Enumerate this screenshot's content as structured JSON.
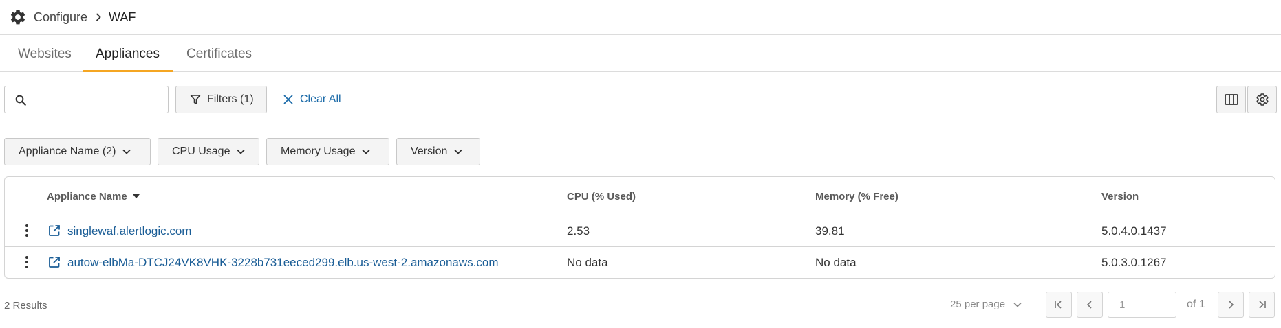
{
  "breadcrumb": {
    "parent": "Configure",
    "current": "WAF"
  },
  "tabs": [
    {
      "label": "Websites",
      "active": false
    },
    {
      "label": "Appliances",
      "active": true
    },
    {
      "label": "Certificates",
      "active": false
    }
  ],
  "toolbar": {
    "search_placeholder": "",
    "search_value": "",
    "filters_label": "Filters (1)",
    "clear_all_label": "Clear All"
  },
  "filter_chips": [
    {
      "label": "Appliance Name (2)"
    },
    {
      "label": "CPU Usage"
    },
    {
      "label": "Memory Usage"
    },
    {
      "label": "Version"
    }
  ],
  "table": {
    "columns": [
      "Appliance Name",
      "CPU (% Used)",
      "Memory (% Free)",
      "Version"
    ],
    "sort": {
      "column": "Appliance Name",
      "direction": "desc"
    },
    "rows": [
      {
        "name": "singlewaf.alertlogic.com",
        "cpu": "2.53",
        "memory": "39.81",
        "version": "5.0.4.0.1437"
      },
      {
        "name": "autow-elbMa-DTCJ24VK8VHK-3228b731eeced299.elb.us-west-2.amazonaws.com",
        "cpu": "No data",
        "memory": "No data",
        "version": "5.0.3.0.1267"
      }
    ]
  },
  "footer": {
    "results": "2 Results",
    "per_page": "25 per page",
    "page_value": "1",
    "of_label": "of 1"
  },
  "colors": {
    "accent_tab": "#f5a623",
    "link": "#1a5d96",
    "clear_all": "#1a6aa8"
  },
  "icons": [
    "gear-icon",
    "chevron-right-icon",
    "search-icon",
    "filter-icon",
    "close-icon",
    "columns-icon",
    "settings-icon",
    "chevron-down-icon",
    "sort-caret-icon",
    "kebab-icon",
    "external-link-icon",
    "first-page-icon",
    "prev-page-icon",
    "next-page-icon",
    "last-page-icon"
  ]
}
